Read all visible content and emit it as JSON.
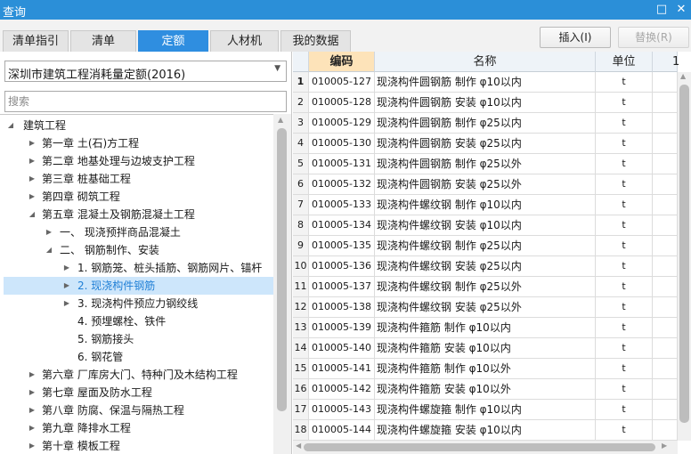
{
  "window": {
    "title": "查询",
    "restore_icon": "□",
    "close_icon": "✕"
  },
  "tabs": [
    {
      "label": "清单指引",
      "active": false
    },
    {
      "label": "清单",
      "active": false
    },
    {
      "label": "定额",
      "active": true
    },
    {
      "label": "人材机",
      "active": false
    },
    {
      "label": "我的数据",
      "active": false
    }
  ],
  "actions": {
    "insert": "插入(I)",
    "replace": "替换(R)"
  },
  "quota_library": {
    "selected": "深圳市建筑工程消耗量定额(2016)"
  },
  "search": {
    "placeholder": "搜索"
  },
  "tree": [
    {
      "label": "建筑工程",
      "level": 0,
      "toggle": "expanded"
    },
    {
      "label": "第一章 土(石)方工程",
      "level": 1,
      "toggle": "collapsed"
    },
    {
      "label": "第二章 地基处理与边坡支护工程",
      "level": 1,
      "toggle": "collapsed"
    },
    {
      "label": "第三章 桩基础工程",
      "level": 1,
      "toggle": "collapsed"
    },
    {
      "label": "第四章 砌筑工程",
      "level": 1,
      "toggle": "collapsed"
    },
    {
      "label": "第五章 混凝土及钢筋混凝土工程",
      "level": 1,
      "toggle": "expanded"
    },
    {
      "label": "一、 现浇预拌商品混凝土",
      "level": 2,
      "toggle": "collapsed"
    },
    {
      "label": "二、 钢筋制作、安装",
      "level": 2,
      "toggle": "expanded"
    },
    {
      "label": "1. 钢筋笼、桩头插筋、钢筋网片、锚杆",
      "level": 3,
      "toggle": "collapsed"
    },
    {
      "label": "2. 现浇构件钢筋",
      "level": 3,
      "toggle": "collapsed",
      "selected": true
    },
    {
      "label": "3. 现浇构件预应力钢绞线",
      "level": 3,
      "toggle": "collapsed"
    },
    {
      "label": "4. 预埋螺栓、铁件",
      "level": 3,
      "toggle": "none"
    },
    {
      "label": "5. 钢筋接头",
      "level": 3,
      "toggle": "none"
    },
    {
      "label": "6. 钢花管",
      "level": 3,
      "toggle": "none"
    },
    {
      "label": "第六章 厂库房大门、特种门及木结构工程",
      "level": 1,
      "toggle": "collapsed"
    },
    {
      "label": "第七章 屋面及防水工程",
      "level": 1,
      "toggle": "collapsed"
    },
    {
      "label": "第八章 防腐、保温与隔热工程",
      "level": 1,
      "toggle": "collapsed"
    },
    {
      "label": "第九章 降排水工程",
      "level": 1,
      "toggle": "collapsed"
    },
    {
      "label": "第十章 模板工程",
      "level": 1,
      "toggle": "collapsed"
    }
  ],
  "table": {
    "columns": {
      "code": "编码",
      "name": "名称",
      "unit": "单位",
      "extra": "1"
    },
    "rows": [
      {
        "idx": "1",
        "code": "010005-127",
        "name": "现浇构件圆钢筋 制作 φ10以内",
        "unit": "t"
      },
      {
        "idx": "2",
        "code": "010005-128",
        "name": "现浇构件圆钢筋 安装 φ10以内",
        "unit": "t"
      },
      {
        "idx": "3",
        "code": "010005-129",
        "name": "现浇构件圆钢筋 制作 φ25以内",
        "unit": "t"
      },
      {
        "idx": "4",
        "code": "010005-130",
        "name": "现浇构件圆钢筋 安装 φ25以内",
        "unit": "t"
      },
      {
        "idx": "5",
        "code": "010005-131",
        "name": "现浇构件圆钢筋 制作 φ25以外",
        "unit": "t"
      },
      {
        "idx": "6",
        "code": "010005-132",
        "name": "现浇构件圆钢筋 安装 φ25以外",
        "unit": "t"
      },
      {
        "idx": "7",
        "code": "010005-133",
        "name": "现浇构件螺纹钢 制作 φ10以内",
        "unit": "t"
      },
      {
        "idx": "8",
        "code": "010005-134",
        "name": "现浇构件螺纹钢 安装 φ10以内",
        "unit": "t"
      },
      {
        "idx": "9",
        "code": "010005-135",
        "name": "现浇构件螺纹钢 制作 φ25以内",
        "unit": "t"
      },
      {
        "idx": "10",
        "code": "010005-136",
        "name": "现浇构件螺纹钢 安装 φ25以内",
        "unit": "t"
      },
      {
        "idx": "11",
        "code": "010005-137",
        "name": "现浇构件螺纹钢 制作 φ25以外",
        "unit": "t"
      },
      {
        "idx": "12",
        "code": "010005-138",
        "name": "现浇构件螺纹钢 安装 φ25以外",
        "unit": "t"
      },
      {
        "idx": "13",
        "code": "010005-139",
        "name": "现浇构件箍筋 制作 φ10以内",
        "unit": "t"
      },
      {
        "idx": "14",
        "code": "010005-140",
        "name": "现浇构件箍筋 安装 φ10以内",
        "unit": "t"
      },
      {
        "idx": "15",
        "code": "010005-141",
        "name": "现浇构件箍筋 制作 φ10以外",
        "unit": "t"
      },
      {
        "idx": "16",
        "code": "010005-142",
        "name": "现浇构件箍筋 安装 φ10以外",
        "unit": "t"
      },
      {
        "idx": "17",
        "code": "010005-143",
        "name": "现浇构件螺旋箍 制作 φ10以内",
        "unit": "t"
      },
      {
        "idx": "18",
        "code": "010005-144",
        "name": "现浇构件螺旋箍 安装 φ10以内",
        "unit": "t"
      }
    ]
  },
  "colors": {
    "titlebar": "#2b8fd8",
    "active_tab": "#2f8ee0",
    "selected_node_bg": "#cde6fb",
    "selected_node_text": "#1f7fd6",
    "sorted_header": "#fde3b9"
  }
}
